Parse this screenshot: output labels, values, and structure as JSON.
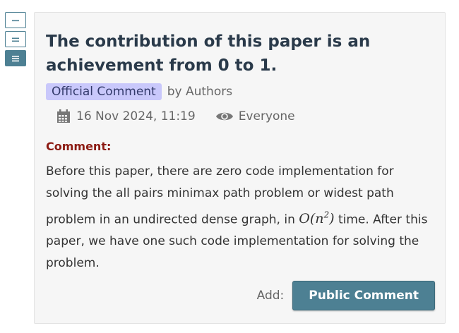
{
  "toggles": [
    {
      "icon": "minus-icon",
      "active": false
    },
    {
      "icon": "equals-icon",
      "active": false
    },
    {
      "icon": "list-icon",
      "active": true
    }
  ],
  "note": {
    "title": "The contribution of this paper is an achievement from 0 to 1.",
    "badge": "Official Comment",
    "byline": "by Authors",
    "date_icon": "calendar-icon",
    "date": "16 Nov 2024, 11:19",
    "visibility_icon": "eye-icon",
    "visibility": "Everyone",
    "comment_label": "Comment:",
    "comment_part1": "Before this paper, there are zero code implementation for solving the all pairs minimax path problem or widest path problem in an undirected dense graph, in ",
    "math_base": "O(n",
    "math_exp": "2",
    "math_close": ")",
    "comment_part2": " time. After this paper, we have one such code implementation for solving the problem.",
    "add_label": "Add:",
    "add_button": "Public Comment"
  },
  "colors": {
    "accent": "#4d8093",
    "badge_bg": "#c9c8fb",
    "comment_label": "#8c1b13",
    "title": "#2a3a4a"
  }
}
